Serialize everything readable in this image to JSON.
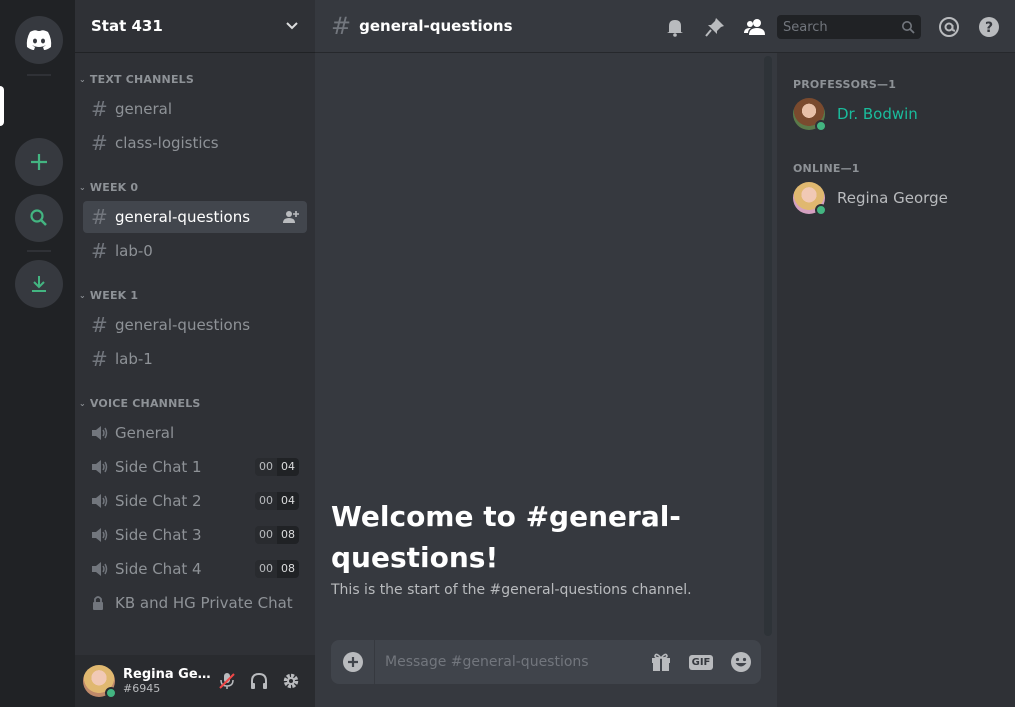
{
  "server": {
    "name": "Stat 431"
  },
  "categories": [
    {
      "name": "TEXT CHANNELS",
      "channels": [
        {
          "name": "general",
          "type": "text"
        },
        {
          "name": "class-logistics",
          "type": "text"
        }
      ]
    },
    {
      "name": "WEEK 0",
      "channels": [
        {
          "name": "general-questions",
          "type": "text",
          "active": true
        },
        {
          "name": "lab-0",
          "type": "text"
        }
      ]
    },
    {
      "name": "WEEK 1",
      "channels": [
        {
          "name": "general-questions",
          "type": "text"
        },
        {
          "name": "lab-1",
          "type": "text"
        }
      ]
    },
    {
      "name": "VOICE CHANNELS",
      "channels": [
        {
          "name": "General",
          "type": "voice"
        },
        {
          "name": "Side Chat 1",
          "type": "voice",
          "count_a": "00",
          "count_b": "04"
        },
        {
          "name": "Side Chat 2",
          "type": "voice",
          "count_a": "00",
          "count_b": "04"
        },
        {
          "name": "Side Chat 3",
          "type": "voice",
          "count_a": "00",
          "count_b": "08"
        },
        {
          "name": "Side Chat 4",
          "type": "voice",
          "count_a": "00",
          "count_b": "08"
        },
        {
          "name": "KB and HG Private Chat",
          "type": "locked"
        }
      ]
    }
  ],
  "user": {
    "name": "Regina Geor...",
    "tag": "#6945"
  },
  "channel": {
    "title": "general-questions",
    "search_placeholder": "Search",
    "welcome_title": "Welcome to #general-questions!",
    "welcome_sub": "This is the start of the #general-questions channel.",
    "message_placeholder": "Message #general-questions"
  },
  "members": {
    "groups": [
      {
        "title": "PROFESSORS—1",
        "members": [
          {
            "name": "Dr. Bodwin",
            "color": "#1abc9c"
          }
        ]
      },
      {
        "title": "ONLINE—1",
        "members": [
          {
            "name": "Regina George",
            "color": "#b9bbbe"
          }
        ]
      }
    ]
  },
  "colors": {
    "accent_green": "#43b581",
    "blurple": "#7289da"
  },
  "icons": {
    "rail": [
      "discord-logo-icon",
      "add-server-icon",
      "explore-icon",
      "download-icon"
    ],
    "header": [
      "bell-icon",
      "pin-icon",
      "members-icon",
      "mention-icon",
      "help-icon"
    ]
  }
}
